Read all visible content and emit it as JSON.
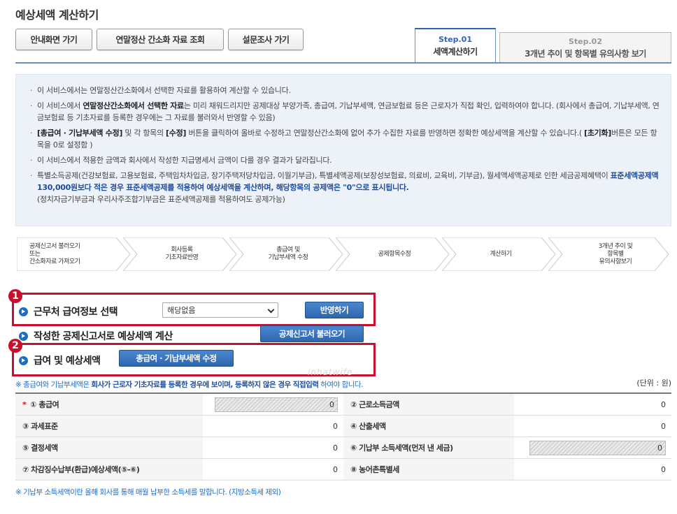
{
  "title": "예상세액 계산하기",
  "top_buttons": [
    "안내화면 가기",
    "연말정산 간소화 자료 조회",
    "설문조사 가기"
  ],
  "step_tabs": [
    {
      "step": "Step.01",
      "label": "세액계산하기"
    },
    {
      "step": "Step.02",
      "label": "3개년 추이 및 항목별 유의사항 보기"
    }
  ],
  "notice": {
    "item1": "이 서비스에서는 연말정산간소화에서 선택한 자료를 활용하여 계산할 수 있습니다.",
    "item2_a": "이 서비스에서 ",
    "item2_b": "연말정산간소화에서 선택한 자료",
    "item2_c": "는 미리 채워드리지만 공제대상 부양가족, 총급여, 기납부세액, 연금보험료 등은 근로자가 직접 확인, 입력하여야 합니다. (회사에서 총급여, 기납부세액, 연금보험료 등 기초자료를 등록한 경우에는 그 자료를 불러와서 반영할 수 있음)",
    "item3_a": "[총급여 · 기납부세액 수정]",
    "item3_b": " 및 각 항목의 ",
    "item3_c": "[수정]",
    "item3_d": " 버튼을 클릭하여 올바로 수정하고 연말정산간소화에 없어 추가 수집한 자료를 반영하면 정확한 예상세액을 계산할 수 있습니다.( ",
    "item3_e": "[초기화]",
    "item3_f": "버튼은 모든 항목을 0로 설정함 )",
    "item4": "이 서비스에서 적용한 금액과 회사에서 작성한 지급명세서 금액이 다를 경우 결과가 달라집니다.",
    "item5_a": "특별소득공제(건강보험료, 고용보험료, 주택임차차입금, 장기주택저당차입금, 이월기부금), 특별세액공제(보장성보험료, 의료비, 교육비, 기부금), 월세액세액공제로 인한 세금공제혜택이 ",
    "item5_b": "표준세액공제액 130,000원보다 적은 경우 표준세액공제를 적용하여 예상세액을 계산하며, 해당항목의 공제액은 \"0\"으로 표시됩니다.",
    "item5_c": "(정치자금기부금과 우리사주조합기부금은 표준세액공제를 적용하여도 공제가능)"
  },
  "flow_steps": [
    "공제신고서 불러오기\n또는\n간소화자료 가져오기",
    "회사등록\n기초자료반영",
    "총급여 및\n기납부세액 수정",
    "공제항목수정",
    "계산하기",
    "3개년 추이 및\n항목별\n유의사항보기"
  ],
  "badges": [
    "1",
    "2"
  ],
  "sections": {
    "workplace": {
      "title": "근무처 급여정보 선택",
      "select_value": "해당없음",
      "button": "반영하기"
    },
    "declaration": {
      "title": "작성한 공제신고서로 예상세액 계산",
      "button": "공제신고서 불러오기"
    },
    "salary": {
      "title": "급여 및 예상세액",
      "button": "총급여 · 기납부세액 수정"
    }
  },
  "note1_a": "※ 총급여와 기납부세액은 ",
  "note1_b": "회사가 근로자 기초자료를 등록한 경우에 보이며, 등록하지 않은 경우 직접입력",
  "note1_c": " 하여야 합니다.",
  "unit": "(단위 : 원)",
  "table": {
    "r1": {
      "l1": "① 총급여",
      "v1": "0",
      "l2": "② 근로소득금액",
      "v2": "0"
    },
    "r2": {
      "l1": "③ 과세표준",
      "v1": "0",
      "l2": "④ 산출세액",
      "v2": "0"
    },
    "r3": {
      "l1": "⑤ 결정세액",
      "v1": "0",
      "l2": "⑥ 기납부 소득세액(먼저 낸 세금)",
      "v2": "0"
    },
    "r4": {
      "l1": "⑦ 차감징수납부(환급)예상세액(⑤-⑥)",
      "v1": "0",
      "l2": "⑧ 농어촌특별세",
      "v2": "0"
    }
  },
  "required_mark": "*",
  "footnote": "※ 기납부 소득세액이란 올해 회사를 통해 매월 납부한 소득세를 말합니다. (지방소득세 제외)",
  "watermark": "inhatwife",
  "colors": {
    "accent": "#1f6cc4",
    "highlight": "#c8102e",
    "notice_bg": "#edf2f9"
  }
}
